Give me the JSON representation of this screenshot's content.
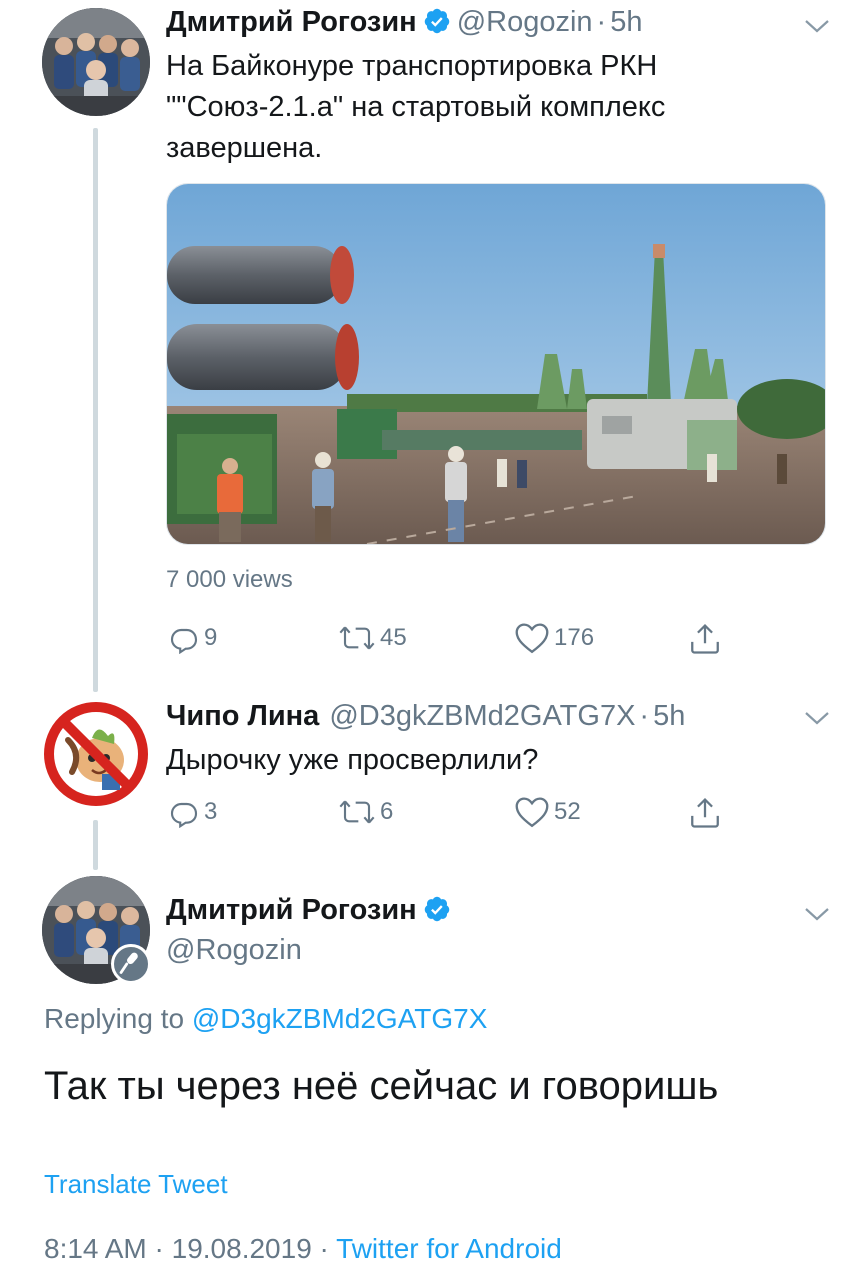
{
  "tweet1": {
    "name": "Дмитрий Рогозин",
    "handle": "@Rogozin",
    "separator": "·",
    "time": "5h",
    "text_lines": [
      "На Байконуре транспортировка РКН",
      "\"\"Союз-2.1.а\" на стартовый комплекс",
      "завершена."
    ],
    "views": "7 000 views",
    "replies": "9",
    "retweets": "45",
    "likes": "176",
    "avatar_icon": "profile-photo",
    "media_icon": "rocket-transport-photo"
  },
  "tweet2": {
    "name": "Чипо Лина",
    "handle": "@D3gkZBMd2GATG7X",
    "separator": "·",
    "time": "5h",
    "text": "Дырочку уже просверлили?",
    "replies": "3",
    "retweets": "6",
    "likes": "52",
    "avatar_icon": "prohibited-chipollino-avatar"
  },
  "tweet3": {
    "name": "Дмитрий Рогозин",
    "handle": "@Rogozin",
    "reply_prefix": "Replying to",
    "reply_mention": "@D3gkZBMd2GATG7X",
    "text": "Так ты через неё сейчас и говоришь",
    "translate": "Translate Tweet",
    "time": "8:14 AM",
    "date": "19.08.2019",
    "separator": "·",
    "source": "Twitter for Android",
    "badge_icon": "microphone-icon"
  },
  "colors": {
    "accent": "#1da1f2",
    "secondary_text": "#657786",
    "thread_line": "#cfd9de"
  }
}
